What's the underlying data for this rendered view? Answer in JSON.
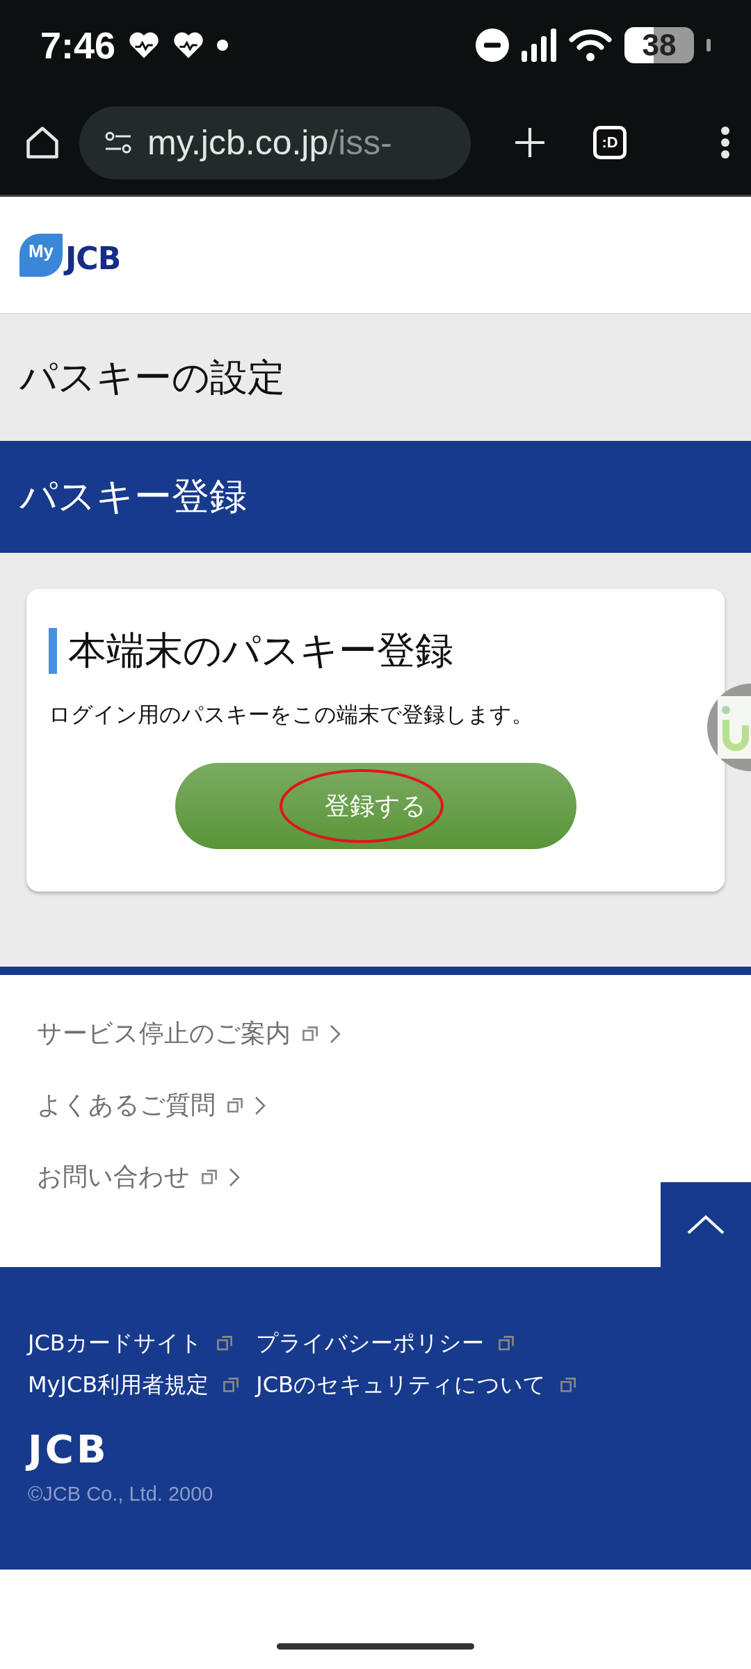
{
  "status_bar": {
    "time": "7:46",
    "battery": "38"
  },
  "browser": {
    "url_host": "my.jcb.co.jp",
    "url_path": "/iss-",
    "tab_switcher": ":D"
  },
  "header": {
    "logo_badge": "My",
    "logo_text": "JCB"
  },
  "page_title": "パスキーの設定",
  "section_title": "パスキー登録",
  "card": {
    "heading": "本端末のパスキー登録",
    "description": "ログイン用のパスキーをこの端末で登録します。",
    "button": "登録する"
  },
  "links": [
    {
      "label": "サービス停止のご案内"
    },
    {
      "label": "よくあるご質問"
    },
    {
      "label": "お問い合わせ"
    }
  ],
  "footer": {
    "links": [
      {
        "label": "JCBカードサイト"
      },
      {
        "label": "プライバシーポリシー"
      },
      {
        "label": "MyJCB利用者規定"
      },
      {
        "label": "JCBのセキュリティについて"
      }
    ],
    "logo": "JCB",
    "copyright": "©JCB Co., Ltd. 2000"
  }
}
